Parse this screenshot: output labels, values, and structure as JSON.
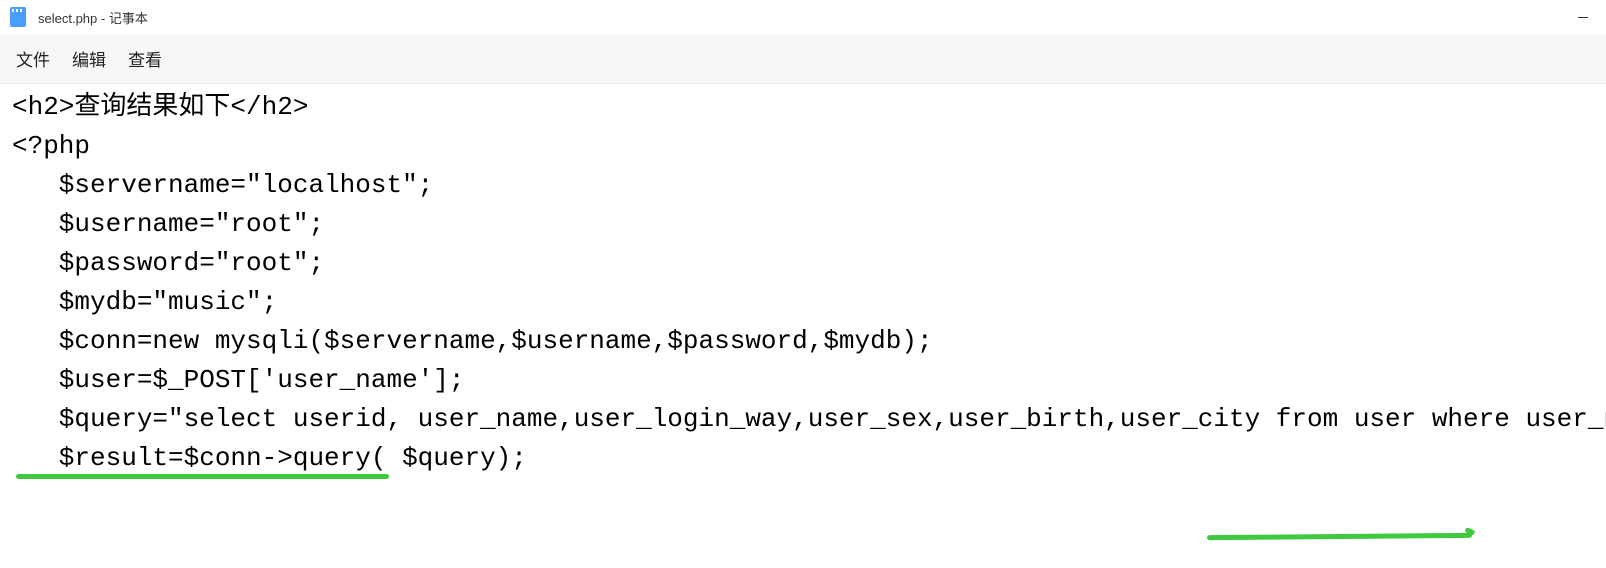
{
  "titlebar": {
    "filename": "select.php - 记事本"
  },
  "menu": {
    "file": "文件",
    "edit": "编辑",
    "view": "查看"
  },
  "code": {
    "line1": "<h2>查询结果如下</h2>",
    "line2": "",
    "line3": "<?php",
    "line4": "   $servername=\"localhost\";",
    "line5": "   $username=\"root\";",
    "line6": "   $password=\"root\";",
    "line7": "   $mydb=\"music\";",
    "line8": "   $conn=new mysqli($servername,$username,$password,$mydb);",
    "line9": "   $user=$_POST['user_name'];",
    "line10": "   $query=\"select userid, user_name,user_login_way,user_sex,user_birth,user_city from user where user_name='$user'\";",
    "line11": "",
    "line12": "   $result=$conn->query( $query);"
  }
}
